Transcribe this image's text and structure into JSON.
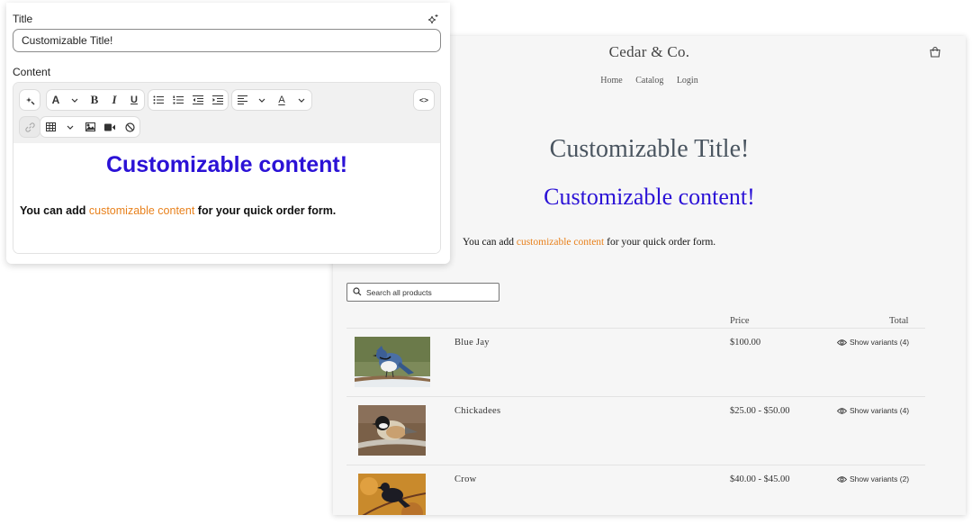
{
  "editor": {
    "title_label": "Title",
    "title_value": "Customizable Title!",
    "content_label": "Content",
    "toolbar": {
      "font_label": "A",
      "bold_label": "B",
      "italic_label": "I",
      "underline_label": "U",
      "code_label": "<>",
      "color_label": "A"
    },
    "body": {
      "heading": "Customizable content!",
      "para_before": "You can add ",
      "para_highlight": "customizable content",
      "para_after": " for your quick order form."
    }
  },
  "store": {
    "brand": "Cedar & Co.",
    "nav": [
      "Home",
      "Catalog",
      "Login"
    ],
    "title": "Customizable Title!",
    "heading": "Customizable content!",
    "para_before": "You can add ",
    "para_highlight": "customizable content",
    "para_after": " for your quick order form.",
    "search_placeholder": "Search all products",
    "columns": {
      "price": "Price",
      "total": "Total"
    },
    "products": [
      {
        "name": "Blue Jay",
        "price": "$100.00",
        "variants": "Show variants (4)"
      },
      {
        "name": "Chickadees",
        "price": "$25.00 - $50.00",
        "variants": "Show variants (4)"
      },
      {
        "name": "Crow",
        "price": "$40.00 - $45.00",
        "variants": "Show variants (2)"
      }
    ]
  },
  "colors": {
    "heading_blue": "#2b12d6",
    "highlight_orange": "#e8811c"
  }
}
